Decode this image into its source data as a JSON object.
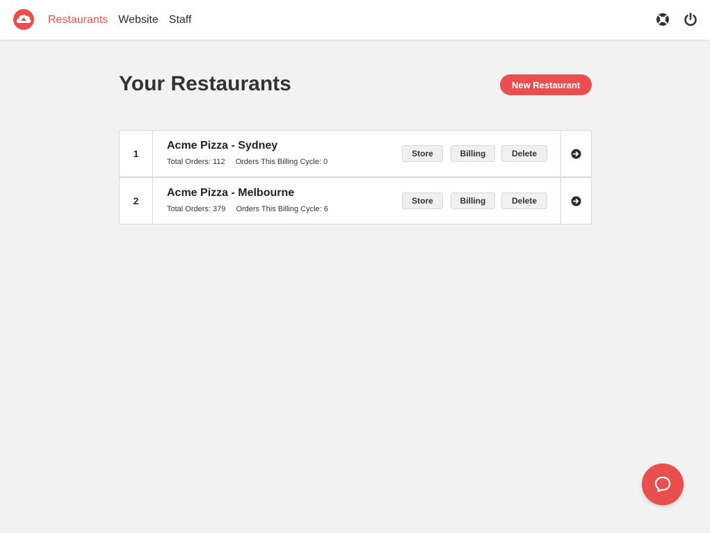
{
  "brand": {
    "accent": "#ea4f4f"
  },
  "nav": {
    "items": [
      {
        "label": "Restaurants",
        "active": true
      },
      {
        "label": "Website",
        "active": false
      },
      {
        "label": "Staff",
        "active": false
      }
    ]
  },
  "header_icons": [
    "help-lifebuoy-icon",
    "power-icon"
  ],
  "page": {
    "title": "Your Restaurants",
    "new_button": "New Restaurant"
  },
  "restaurants": [
    {
      "index": "1",
      "name": "Acme Pizza - Sydney",
      "total_orders": "Total Orders: 112",
      "billing_cycle_orders": "Orders This Billing Cycle: 0",
      "buttons": {
        "store": "Store",
        "billing": "Billing",
        "delete": "Delete"
      }
    },
    {
      "index": "2",
      "name": "Acme Pizza - Melbourne",
      "total_orders": "Total Orders: 379",
      "billing_cycle_orders": "Orders This Billing Cycle: 6",
      "buttons": {
        "store": "Store",
        "billing": "Billing",
        "delete": "Delete"
      }
    }
  ],
  "chat": {
    "icon": "chat-bubble-icon"
  }
}
